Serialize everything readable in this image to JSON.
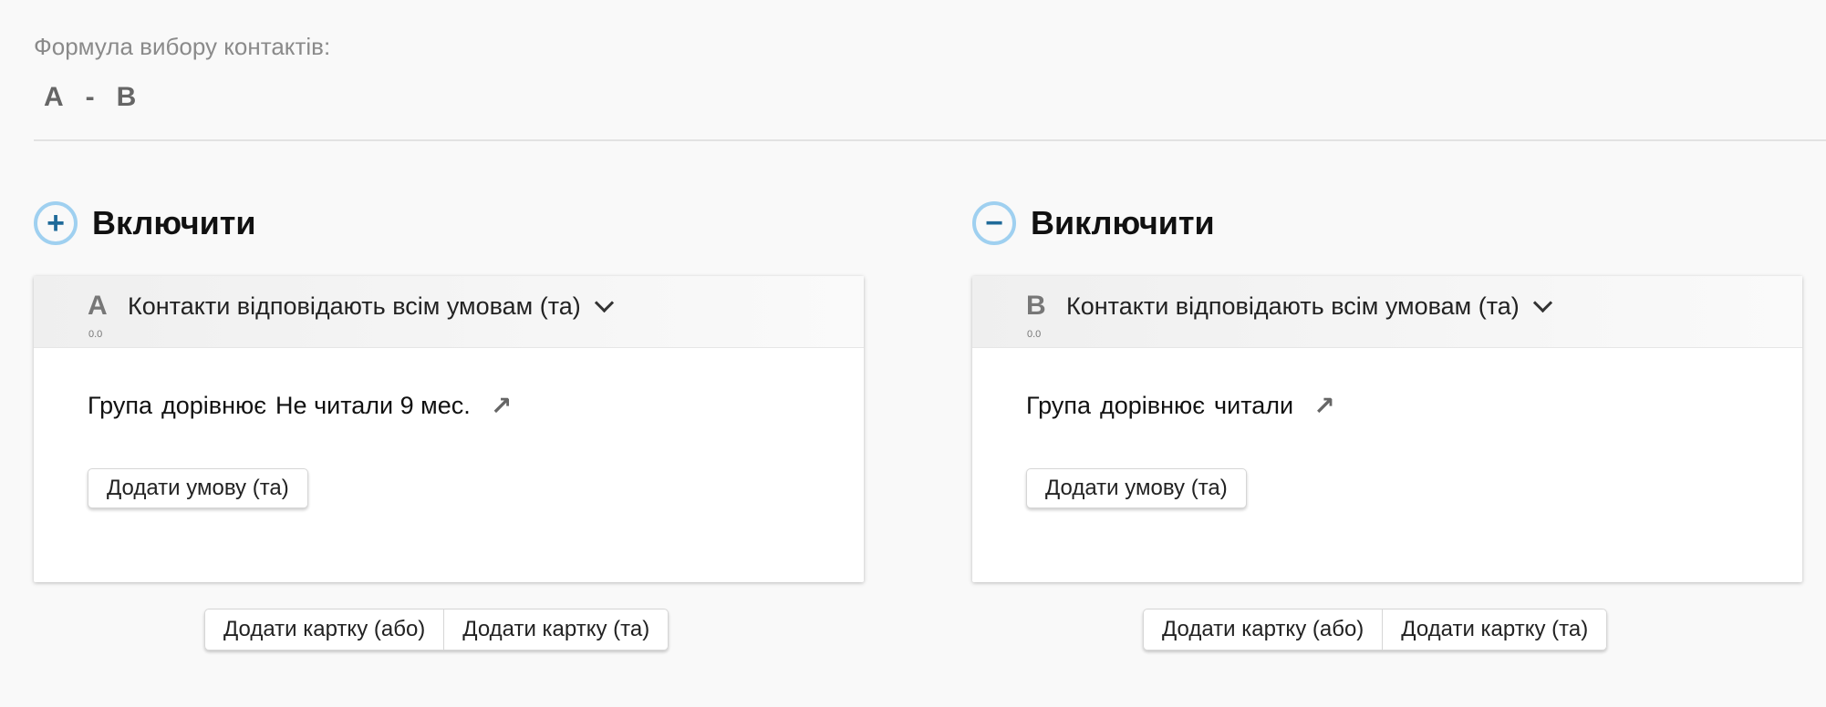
{
  "formula": {
    "label": "Формула вибору контактів:",
    "left": "A",
    "operator": "-",
    "right": "B"
  },
  "sections": [
    {
      "icon": "plus-icon",
      "icon_glyph": "+",
      "title": "Включити",
      "card": {
        "letter": "A",
        "version": "0.0",
        "mode": "Контакти відповідають всім умовам (та)",
        "condition": {
          "field": "Група",
          "operator": "дорівнює",
          "value": "Не читали 9 мес."
        },
        "add_condition": "Додати умову (та)"
      },
      "add_card_or": "Додати картку (або)",
      "add_card_and": "Додати картку (та)"
    },
    {
      "icon": "minus-icon",
      "icon_glyph": "−",
      "title": "Виключити",
      "card": {
        "letter": "B",
        "version": "0.0",
        "mode": "Контакти відповідають всім умовам (та)",
        "condition": {
          "field": "Група",
          "operator": "дорівнює",
          "value": "читали"
        },
        "add_condition": "Додати умову (та)"
      },
      "add_card_or": "Додати картку (або)",
      "add_card_and": "Додати картку (та)"
    }
  ],
  "icons": {
    "condition_link": "arrow-up-right-icon",
    "mode_dropdown": "chevron-down-icon"
  },
  "colors": {
    "icon_ring": "#9fd0f0",
    "icon_glyph": "#1f6a99",
    "background": "#f9f9f9"
  }
}
